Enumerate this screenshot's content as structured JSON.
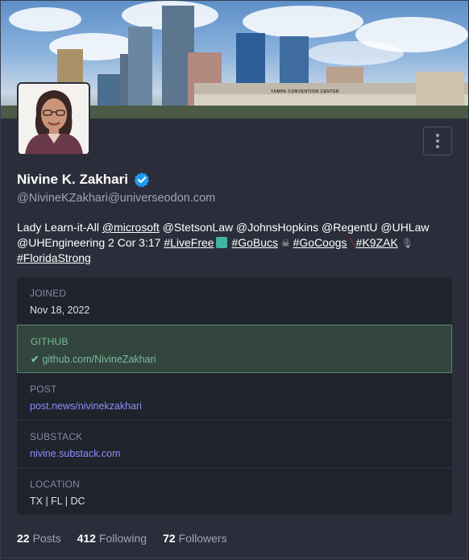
{
  "profile": {
    "display_name": "Nivine K. Zakhari",
    "handle": "@NivineKZakhari@universeodon.com",
    "header_sign": "TAMPA CONVENTION CENTER",
    "bio": {
      "prefix": "Lady Learn-it-All ",
      "mention_microsoft": "@microsoft",
      "middle1": " @StetsonLaw @JohnsHopkins @RegentU @UHLaw @UHEngineering 2 Cor 3:17 ",
      "tag_livefree": "#LiveFree",
      "tag_gobucs": "#GoBucs",
      "tag_gocoogs": "#GoCoogs",
      "tag_k9zak": "#K9ZAK",
      "tag_floridastrong": "#FloridaStrong"
    }
  },
  "fields": [
    {
      "label": "JOINED",
      "value": "Nov 18, 2022"
    },
    {
      "label": "GITHUB",
      "value": "github.com/NivineZakhari"
    },
    {
      "label": "POST",
      "value": "post.news/nivinekzakhari"
    },
    {
      "label": "SUBSTACK",
      "value": "nivine.substack.com"
    },
    {
      "label": "LOCATION",
      "value": "TX | FL | DC"
    }
  ],
  "stats": {
    "posts_count": "22",
    "posts_label": "Posts",
    "following_count": "412",
    "following_label": "Following",
    "followers_count": "72",
    "followers_label": "Followers"
  },
  "icons": {
    "verified": "verified-badge-icon",
    "menu": "kebab-menu-icon",
    "check": "check-icon"
  },
  "colors": {
    "background": "#282c37",
    "field_bg": "#1f232b",
    "verified_field_bg": "#32453e",
    "verified_green": "#79bd9a",
    "link": "#8c8dff",
    "badge_blue": "#1d9bf0"
  }
}
